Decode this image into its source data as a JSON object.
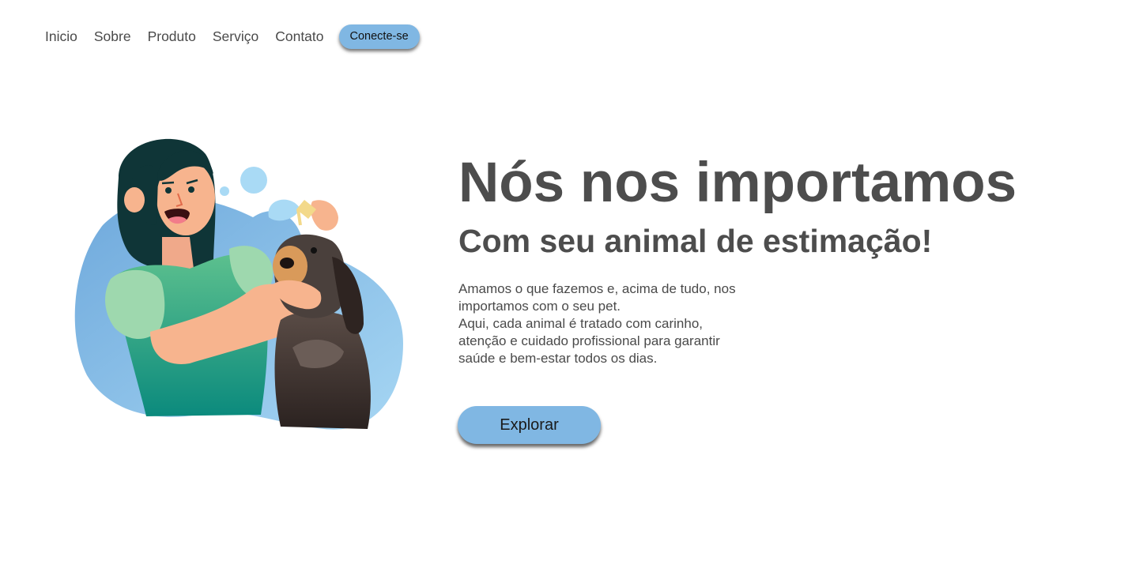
{
  "nav": {
    "links": [
      "Inicio",
      "Sobre",
      "Produto",
      "Serviço",
      "Contato"
    ],
    "cta_label": "Conecte-se"
  },
  "hero": {
    "title": "Nós nos importamos",
    "subtitle": "Com seu animal de estimação!",
    "description_lines": [
      "Amamos o que fazemos e, acima de tudo, nos",
      "importamos com o seu pet.",
      "Aqui, cada animal é tratado com carinho,",
      "atenção e cuidado profissional para garantir",
      "saúde e bem-estar todos os dias."
    ],
    "button_label": "Explorar"
  },
  "illustration": {
    "icon": "vet-woman-with-dog-icon"
  },
  "colors": {
    "accent": "#80b7e3",
    "text": "#4d4d4d",
    "blob": "#8cc3ec",
    "shirt": "#1e9e7f",
    "dog": "#4a403c"
  }
}
